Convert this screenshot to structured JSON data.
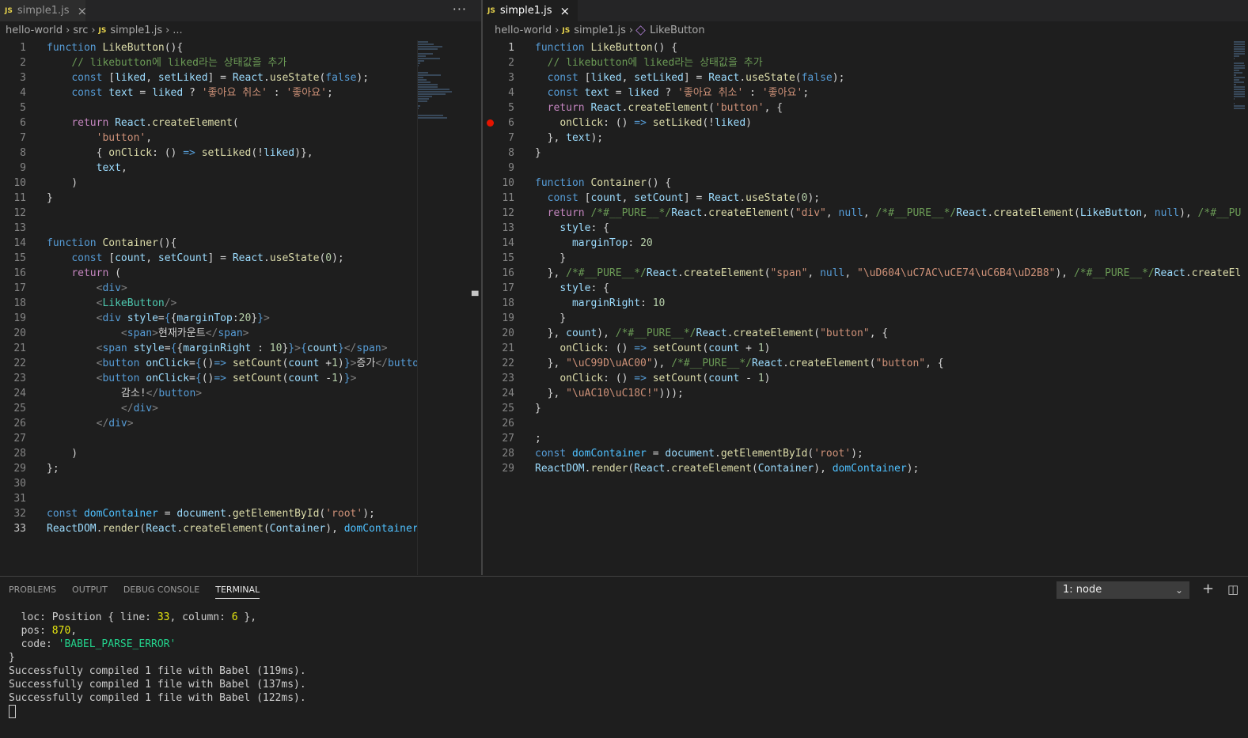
{
  "left": {
    "tab": {
      "icon": "JS",
      "label": "simple1.js"
    },
    "more": "···",
    "breadcrumb": {
      "folder1": "hello-world",
      "folder2": "src",
      "file": "simple1.js",
      "tail": "..."
    },
    "lines": [
      {
        "n": "1",
        "html": "<span class=\"k\">function</span> <span class=\"f\">LikeButton</span>(){"
      },
      {
        "n": "2",
        "html": "    <span class=\"cm\">// likebutton에 liked라는 상태값을 추가</span>"
      },
      {
        "n": "3",
        "html": "    <span class=\"k\">const</span> [<span class=\"v\">liked</span>, <span class=\"v\">setLiked</span>] = <span class=\"v\">React</span>.<span class=\"f\">useState</span>(<span class=\"k\">false</span>);"
      },
      {
        "n": "4",
        "html": "    <span class=\"k\">const</span> <span class=\"v\">text</span> = <span class=\"v\">liked</span> ? <span class=\"s\">'좋아요 취소'</span> : <span class=\"s\">'좋아요'</span>;"
      },
      {
        "n": "5",
        "html": ""
      },
      {
        "n": "6",
        "html": "    <span class=\"kc\">return</span> <span class=\"v\">React</span>.<span class=\"f\">createElement</span>("
      },
      {
        "n": "7",
        "html": "        <span class=\"s\">'button'</span>,"
      },
      {
        "n": "8",
        "html": "        { <span class=\"f\">onClick</span>: () <span class=\"k\">=&gt;</span> <span class=\"f\">setLiked</span>(!<span class=\"v\">liked</span>)},"
      },
      {
        "n": "9",
        "html": "        <span class=\"v\">text</span>,"
      },
      {
        "n": "10",
        "html": "    )"
      },
      {
        "n": "11",
        "html": "}"
      },
      {
        "n": "12",
        "html": ""
      },
      {
        "n": "13",
        "html": ""
      },
      {
        "n": "14",
        "html": "<span class=\"k\">function</span> <span class=\"f\">Container</span>(){"
      },
      {
        "n": "15",
        "html": "    <span class=\"k\">const</span> [<span class=\"v\">count</span>, <span class=\"v\">setCount</span>] = <span class=\"v\">React</span>.<span class=\"f\">useState</span>(<span class=\"n\">0</span>);"
      },
      {
        "n": "16",
        "html": "    <span class=\"kc\">return</span> ("
      },
      {
        "n": "17",
        "html": "        <span class=\"t\">&lt;</span><span class=\"tg\">div</span><span class=\"t\">&gt;</span>"
      },
      {
        "n": "18",
        "html": "        <span class=\"t\">&lt;</span><span class=\"tn\">LikeButton</span><span class=\"t\">/&gt;</span>"
      },
      {
        "n": "19",
        "html": "        <span class=\"t\">&lt;</span><span class=\"tg\">div</span> <span class=\"attr\">style</span>=<span class=\"k\">{</span>{<span class=\"attr\">marginTop</span>:<span class=\"n\">20</span>}<span class=\"k\">}</span><span class=\"t\">&gt;</span>"
      },
      {
        "n": "20",
        "html": "            <span class=\"t\">&lt;</span><span class=\"tg\">span</span><span class=\"t\">&gt;</span>현재카운트<span class=\"t\">&lt;/</span><span class=\"tg\">span</span><span class=\"t\">&gt;</span>"
      },
      {
        "n": "21",
        "html": "        <span class=\"t\">&lt;</span><span class=\"tg\">span</span> <span class=\"attr\">style</span>=<span class=\"k\">{</span>{<span class=\"attr\">marginRight</span> : <span class=\"n\">10</span>}<span class=\"k\">}</span><span class=\"t\">&gt;</span><span class=\"k\">{</span><span class=\"v\">count</span><span class=\"k\">}</span><span class=\"t\">&lt;/</span><span class=\"tg\">span</span><span class=\"t\">&gt;</span>"
      },
      {
        "n": "22",
        "html": "        <span class=\"t\">&lt;</span><span class=\"tg\">button</span> <span class=\"attr\">onClick</span>=<span class=\"k\">{</span>()<span class=\"k\">=&gt;</span> <span class=\"f\">setCount</span>(<span class=\"v\">count</span> +<span class=\"n\">1</span>)<span class=\"k\">}</span><span class=\"t\">&gt;</span>증가<span class=\"t\">&lt;/</span><span class=\"tg\">button</span>"
      },
      {
        "n": "23",
        "html": "        <span class=\"t\">&lt;</span><span class=\"tg\">button</span> <span class=\"attr\">onClick</span>=<span class=\"k\">{</span>()<span class=\"k\">=&gt;</span> <span class=\"f\">setCount</span>(<span class=\"v\">count</span> -<span class=\"n\">1</span>)<span class=\"k\">}</span><span class=\"t\">&gt;</span>"
      },
      {
        "n": "24",
        "html": "            감소!<span class=\"t\">&lt;/</span><span class=\"tg\">button</span><span class=\"t\">&gt;</span>"
      },
      {
        "n": "25",
        "html": "            <span class=\"t\">&lt;/</span><span class=\"tg\">div</span><span class=\"t\">&gt;</span>"
      },
      {
        "n": "26",
        "html": "        <span class=\"t\">&lt;/</span><span class=\"tg\">div</span><span class=\"t\">&gt;</span>"
      },
      {
        "n": "27",
        "html": ""
      },
      {
        "n": "28",
        "html": "    )"
      },
      {
        "n": "29",
        "html": "};"
      },
      {
        "n": "30",
        "html": ""
      },
      {
        "n": "31",
        "html": ""
      },
      {
        "n": "32",
        "html": "<span class=\"k\">const</span> <span class=\"c\">domContainer</span> = <span class=\"v\">document</span>.<span class=\"f\">getElementById</span>(<span class=\"s\">'root'</span>);"
      },
      {
        "n": "33",
        "html": "<span class=\"v\">ReactDOM</span>.<span class=\"f\">render</span>(<span class=\"v\">React</span>.<span class=\"f\">createElement</span>(<span class=\"v\">Container</span>), <span class=\"c\">domContainer</span>)"
      }
    ]
  },
  "right": {
    "tab": {
      "icon": "JS",
      "label": "simple1.js"
    },
    "breadcrumb": {
      "folder1": "hello-world",
      "file": "simple1.js",
      "symbol": "LikeButton"
    },
    "lines": [
      {
        "n": "1",
        "html": "<span class=\"k\">function</span> <span class=\"f\">LikeButton</span>() {"
      },
      {
        "n": "2",
        "html": "  <span class=\"cm\">// likebutton에 liked라는 상태값을 추가</span>"
      },
      {
        "n": "3",
        "html": "  <span class=\"k\">const</span> [<span class=\"v\">liked</span>, <span class=\"v\">setLiked</span>] = <span class=\"v\">React</span>.<span class=\"f\">useState</span>(<span class=\"k\">false</span>);"
      },
      {
        "n": "4",
        "html": "  <span class=\"k\">const</span> <span class=\"v\">text</span> = <span class=\"v\">liked</span> ? <span class=\"s\">'좋아요 취소'</span> : <span class=\"s\">'좋아요'</span>;"
      },
      {
        "n": "5",
        "html": "  <span class=\"kc\">return</span> <span class=\"v\">React</span>.<span class=\"f\">createElement</span>(<span class=\"s\">'button'</span>, {"
      },
      {
        "n": "6",
        "html": "    <span class=\"f\">onClick</span>: () <span class=\"k\">=&gt;</span> <span class=\"f\">setLiked</span>(!<span class=\"v\">liked</span>)",
        "bp": true
      },
      {
        "n": "7",
        "html": "  }, <span class=\"v\">text</span>);"
      },
      {
        "n": "8",
        "html": "}"
      },
      {
        "n": "9",
        "html": ""
      },
      {
        "n": "10",
        "html": "<span class=\"k\">function</span> <span class=\"f\">Container</span>() {"
      },
      {
        "n": "11",
        "html": "  <span class=\"k\">const</span> [<span class=\"v\">count</span>, <span class=\"v\">setCount</span>] = <span class=\"v\">React</span>.<span class=\"f\">useState</span>(<span class=\"n\">0</span>);"
      },
      {
        "n": "12",
        "html": "  <span class=\"kc\">return</span> <span class=\"cm\">/*#__PURE__*/</span><span class=\"v\">React</span>.<span class=\"f\">createElement</span>(<span class=\"s\">\"div\"</span>, <span class=\"k\">null</span>, <span class=\"cm\">/*#__PURE__*/</span><span class=\"v\">React</span>.<span class=\"f\">createElement</span>(<span class=\"v\">LikeButton</span>, <span class=\"k\">null</span>), <span class=\"cm\">/*#__PU</span>"
      },
      {
        "n": "13",
        "html": "    <span class=\"v\">style</span>: {"
      },
      {
        "n": "14",
        "html": "      <span class=\"v\">marginTop</span>: <span class=\"n\">20</span>"
      },
      {
        "n": "15",
        "html": "    }"
      },
      {
        "n": "16",
        "html": "  }, <span class=\"cm\">/*#__PURE__*/</span><span class=\"v\">React</span>.<span class=\"f\">createElement</span>(<span class=\"s\">\"span\"</span>, <span class=\"k\">null</span>, <span class=\"s\">\"\\uD604\\uC7AC\\uCE74\\uC6B4\\uD2B8\"</span>), <span class=\"cm\">/*#__PURE__*/</span><span class=\"v\">React</span>.<span class=\"f\">createEl</span>"
      },
      {
        "n": "17",
        "html": "    <span class=\"v\">style</span>: {"
      },
      {
        "n": "18",
        "html": "      <span class=\"v\">marginRight</span>: <span class=\"n\">10</span>"
      },
      {
        "n": "19",
        "html": "    }"
      },
      {
        "n": "20",
        "html": "  }, <span class=\"v\">count</span>), <span class=\"cm\">/*#__PURE__*/</span><span class=\"v\">React</span>.<span class=\"f\">createElement</span>(<span class=\"s\">\"button\"</span>, {"
      },
      {
        "n": "21",
        "html": "    <span class=\"f\">onClick</span>: () <span class=\"k\">=&gt;</span> <span class=\"f\">setCount</span>(<span class=\"v\">count</span> + <span class=\"n\">1</span>)"
      },
      {
        "n": "22",
        "html": "  }, <span class=\"s\">\"\\uC99D\\uAC00\"</span>), <span class=\"cm\">/*#__PURE__*/</span><span class=\"v\">React</span>.<span class=\"f\">createElement</span>(<span class=\"s\">\"button\"</span>, {"
      },
      {
        "n": "23",
        "html": "    <span class=\"f\">onClick</span>: () <span class=\"k\">=&gt;</span> <span class=\"f\">setCount</span>(<span class=\"v\">count</span> - <span class=\"n\">1</span>)"
      },
      {
        "n": "24",
        "html": "  }, <span class=\"s\">\"\\uAC10\\uC18C!\"</span>)));"
      },
      {
        "n": "25",
        "html": "}"
      },
      {
        "n": "26",
        "html": ""
      },
      {
        "n": "27",
        "html": ";"
      },
      {
        "n": "28",
        "html": "<span class=\"k\">const</span> <span class=\"c\">domContainer</span> = <span class=\"v\">document</span>.<span class=\"f\">getElementById</span>(<span class=\"s\">'root'</span>);"
      },
      {
        "n": "29",
        "html": "<span class=\"v\">ReactDOM</span>.<span class=\"f\">render</span>(<span class=\"v\">React</span>.<span class=\"f\">createElement</span>(<span class=\"v\">Container</span>), <span class=\"c\">domContainer</span>);"
      }
    ]
  },
  "panel": {
    "tabs": [
      "PROBLEMS",
      "OUTPUT",
      "DEBUG CONSOLE",
      "TERMINAL"
    ],
    "active_tab": "TERMINAL",
    "terminal_select": "1: node",
    "add_icon": "+",
    "split_icon": "◫",
    "terminal_lines": [
      "  loc: Position { line: <span class=\"num\">33</span>, column: <span class=\"num\">6</span> },",
      "  pos: <span class=\"num\">870</span>,",
      "  code: <span class=\"grn\">'BABEL_PARSE_ERROR'</span>",
      "}",
      "Successfully compiled 1 file with Babel (119ms).",
      "Successfully compiled 1 file with Babel (137ms).",
      "Successfully compiled 1 file with Babel (122ms)."
    ]
  }
}
